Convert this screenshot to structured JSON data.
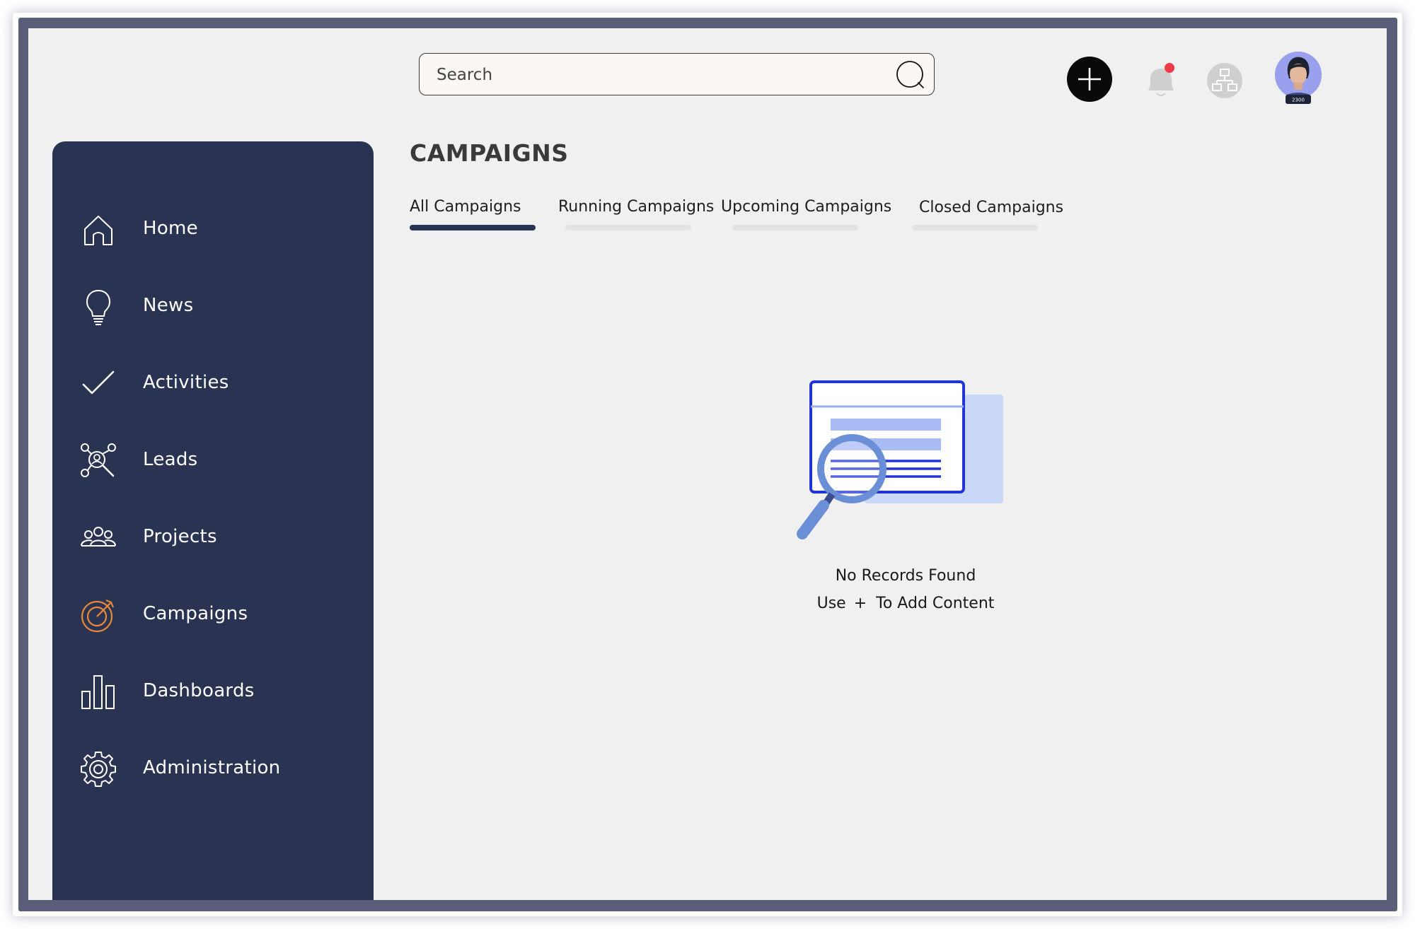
{
  "header": {
    "search_placeholder": "Search",
    "avatar_badge": "2300"
  },
  "sidebar": {
    "items": [
      {
        "label": "Home",
        "icon": "home-icon"
      },
      {
        "label": "News",
        "icon": "lightbulb-icon"
      },
      {
        "label": "Activities",
        "icon": "check-icon"
      },
      {
        "label": "Leads",
        "icon": "leads-network-icon"
      },
      {
        "label": "Projects",
        "icon": "people-group-icon"
      },
      {
        "label": "Campaigns",
        "icon": "target-icon"
      },
      {
        "label": "Dashboards",
        "icon": "bar-chart-icon"
      },
      {
        "label": "Administration",
        "icon": "gear-icon"
      }
    ]
  },
  "main": {
    "title": "CAMPAIGNS",
    "tabs": [
      {
        "label": "All Campaigns",
        "active": true
      },
      {
        "label": "Running Campaigns",
        "active": false
      },
      {
        "label": "Upcoming Campaigns",
        "active": false
      },
      {
        "label": "Closed Campaigns",
        "active": false
      }
    ],
    "empty_state": {
      "title": "No Records Found",
      "hint_prefix": "Use",
      "hint_symbol": "+",
      "hint_suffix": "To Add Content"
    }
  },
  "colors": {
    "sidebar_bg": "#2b3353",
    "accent_orange": "#e8883a",
    "notification_dot": "#ef3b4a",
    "illustration_blue": "#2233d8"
  }
}
